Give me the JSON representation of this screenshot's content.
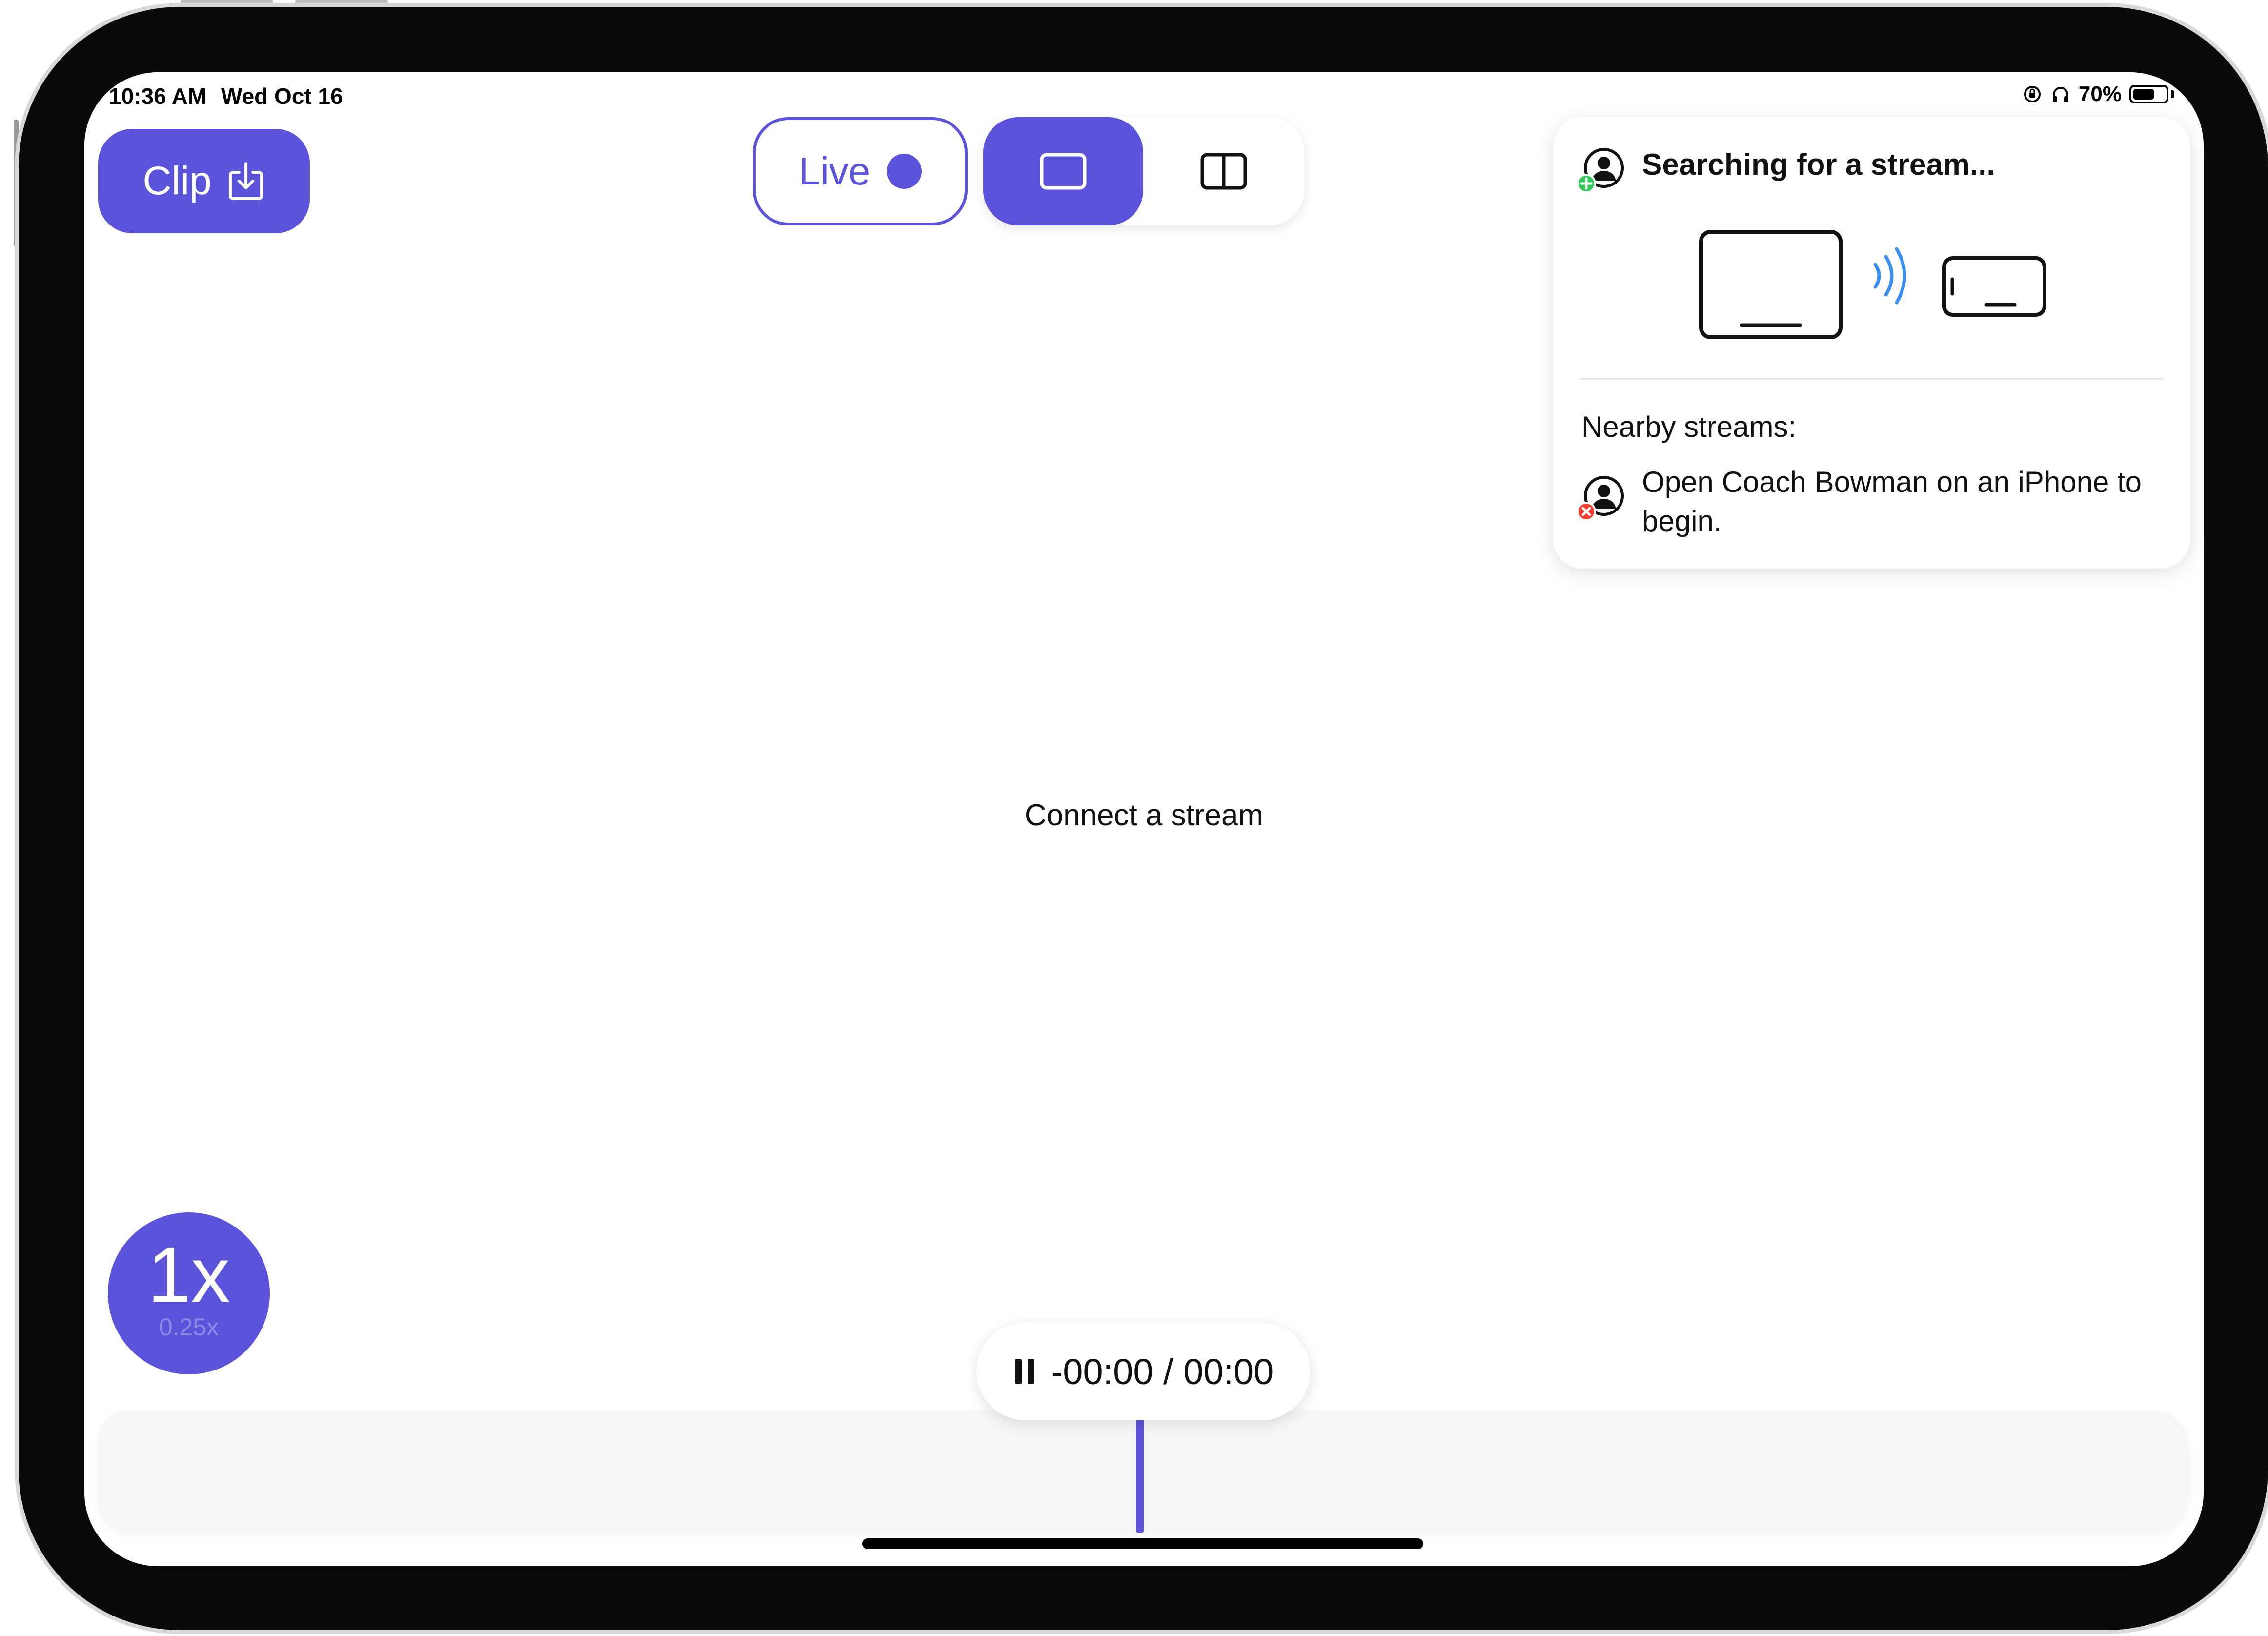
{
  "status_bar": {
    "time": "10:36 AM",
    "date": "Wed Oct 16",
    "battery_percent": "70%",
    "battery_level": 0.7
  },
  "toolbar": {
    "clip_label": "Clip",
    "live_label": "Live",
    "layout_selected": "single"
  },
  "stream_card": {
    "title": "Searching for a stream...",
    "nearby_label": "Nearby streams:",
    "nearby_message": "Open Coach Bowman on an iPhone to begin."
  },
  "main": {
    "placeholder": "Connect a stream"
  },
  "playback": {
    "speed": "1x",
    "speed_alt": "0.25x",
    "time_display": "-00:00 / 00:00"
  },
  "colors": {
    "accent": "#5b53d9",
    "signal": "#3a8ef0",
    "add_badge": "#34c759",
    "error_badge": "#ff3b30"
  }
}
